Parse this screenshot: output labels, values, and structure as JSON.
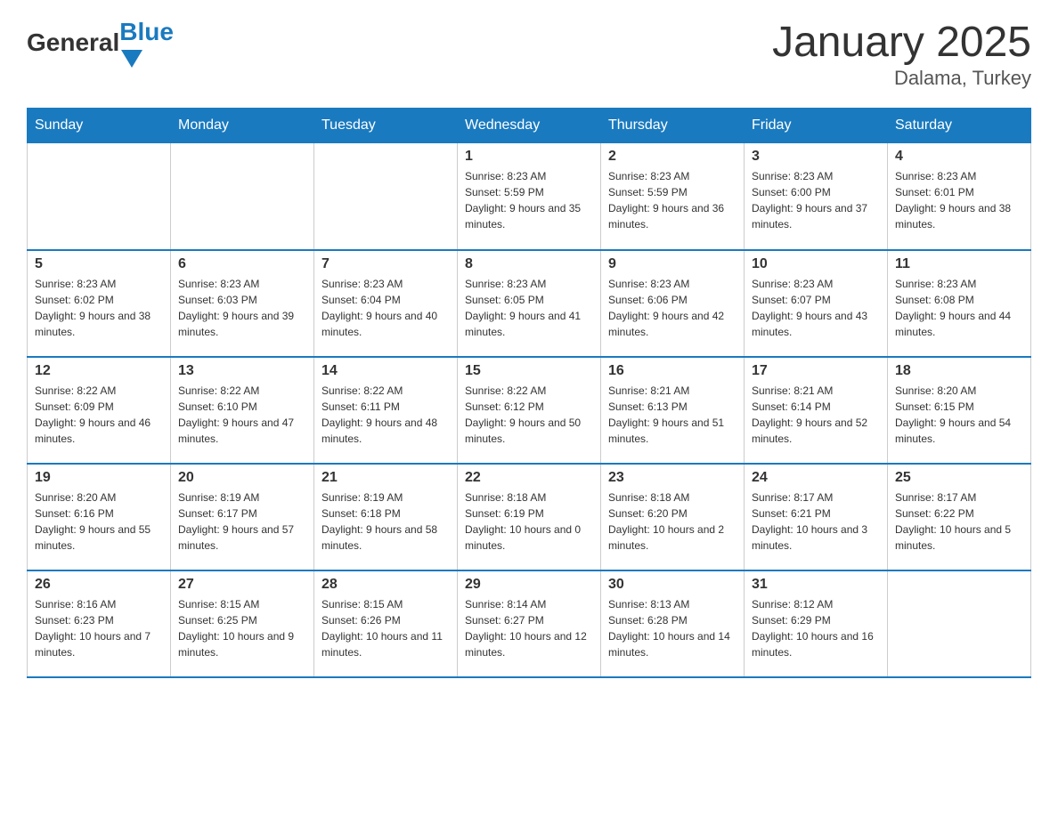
{
  "logo": {
    "general": "General",
    "blue": "Blue",
    "triangle": "▲"
  },
  "header": {
    "month_year": "January 2025",
    "location": "Dalama, Turkey"
  },
  "weekdays": [
    "Sunday",
    "Monday",
    "Tuesday",
    "Wednesday",
    "Thursday",
    "Friday",
    "Saturday"
  ],
  "weeks": [
    [
      {
        "day": "",
        "sunrise": "",
        "sunset": "",
        "daylight": ""
      },
      {
        "day": "",
        "sunrise": "",
        "sunset": "",
        "daylight": ""
      },
      {
        "day": "",
        "sunrise": "",
        "sunset": "",
        "daylight": ""
      },
      {
        "day": "1",
        "sunrise": "Sunrise: 8:23 AM",
        "sunset": "Sunset: 5:59 PM",
        "daylight": "Daylight: 9 hours and 35 minutes."
      },
      {
        "day": "2",
        "sunrise": "Sunrise: 8:23 AM",
        "sunset": "Sunset: 5:59 PM",
        "daylight": "Daylight: 9 hours and 36 minutes."
      },
      {
        "day": "3",
        "sunrise": "Sunrise: 8:23 AM",
        "sunset": "Sunset: 6:00 PM",
        "daylight": "Daylight: 9 hours and 37 minutes."
      },
      {
        "day": "4",
        "sunrise": "Sunrise: 8:23 AM",
        "sunset": "Sunset: 6:01 PM",
        "daylight": "Daylight: 9 hours and 38 minutes."
      }
    ],
    [
      {
        "day": "5",
        "sunrise": "Sunrise: 8:23 AM",
        "sunset": "Sunset: 6:02 PM",
        "daylight": "Daylight: 9 hours and 38 minutes."
      },
      {
        "day": "6",
        "sunrise": "Sunrise: 8:23 AM",
        "sunset": "Sunset: 6:03 PM",
        "daylight": "Daylight: 9 hours and 39 minutes."
      },
      {
        "day": "7",
        "sunrise": "Sunrise: 8:23 AM",
        "sunset": "Sunset: 6:04 PM",
        "daylight": "Daylight: 9 hours and 40 minutes."
      },
      {
        "day": "8",
        "sunrise": "Sunrise: 8:23 AM",
        "sunset": "Sunset: 6:05 PM",
        "daylight": "Daylight: 9 hours and 41 minutes."
      },
      {
        "day": "9",
        "sunrise": "Sunrise: 8:23 AM",
        "sunset": "Sunset: 6:06 PM",
        "daylight": "Daylight: 9 hours and 42 minutes."
      },
      {
        "day": "10",
        "sunrise": "Sunrise: 8:23 AM",
        "sunset": "Sunset: 6:07 PM",
        "daylight": "Daylight: 9 hours and 43 minutes."
      },
      {
        "day": "11",
        "sunrise": "Sunrise: 8:23 AM",
        "sunset": "Sunset: 6:08 PM",
        "daylight": "Daylight: 9 hours and 44 minutes."
      }
    ],
    [
      {
        "day": "12",
        "sunrise": "Sunrise: 8:22 AM",
        "sunset": "Sunset: 6:09 PM",
        "daylight": "Daylight: 9 hours and 46 minutes."
      },
      {
        "day": "13",
        "sunrise": "Sunrise: 8:22 AM",
        "sunset": "Sunset: 6:10 PM",
        "daylight": "Daylight: 9 hours and 47 minutes."
      },
      {
        "day": "14",
        "sunrise": "Sunrise: 8:22 AM",
        "sunset": "Sunset: 6:11 PM",
        "daylight": "Daylight: 9 hours and 48 minutes."
      },
      {
        "day": "15",
        "sunrise": "Sunrise: 8:22 AM",
        "sunset": "Sunset: 6:12 PM",
        "daylight": "Daylight: 9 hours and 50 minutes."
      },
      {
        "day": "16",
        "sunrise": "Sunrise: 8:21 AM",
        "sunset": "Sunset: 6:13 PM",
        "daylight": "Daylight: 9 hours and 51 minutes."
      },
      {
        "day": "17",
        "sunrise": "Sunrise: 8:21 AM",
        "sunset": "Sunset: 6:14 PM",
        "daylight": "Daylight: 9 hours and 52 minutes."
      },
      {
        "day": "18",
        "sunrise": "Sunrise: 8:20 AM",
        "sunset": "Sunset: 6:15 PM",
        "daylight": "Daylight: 9 hours and 54 minutes."
      }
    ],
    [
      {
        "day": "19",
        "sunrise": "Sunrise: 8:20 AM",
        "sunset": "Sunset: 6:16 PM",
        "daylight": "Daylight: 9 hours and 55 minutes."
      },
      {
        "day": "20",
        "sunrise": "Sunrise: 8:19 AM",
        "sunset": "Sunset: 6:17 PM",
        "daylight": "Daylight: 9 hours and 57 minutes."
      },
      {
        "day": "21",
        "sunrise": "Sunrise: 8:19 AM",
        "sunset": "Sunset: 6:18 PM",
        "daylight": "Daylight: 9 hours and 58 minutes."
      },
      {
        "day": "22",
        "sunrise": "Sunrise: 8:18 AM",
        "sunset": "Sunset: 6:19 PM",
        "daylight": "Daylight: 10 hours and 0 minutes."
      },
      {
        "day": "23",
        "sunrise": "Sunrise: 8:18 AM",
        "sunset": "Sunset: 6:20 PM",
        "daylight": "Daylight: 10 hours and 2 minutes."
      },
      {
        "day": "24",
        "sunrise": "Sunrise: 8:17 AM",
        "sunset": "Sunset: 6:21 PM",
        "daylight": "Daylight: 10 hours and 3 minutes."
      },
      {
        "day": "25",
        "sunrise": "Sunrise: 8:17 AM",
        "sunset": "Sunset: 6:22 PM",
        "daylight": "Daylight: 10 hours and 5 minutes."
      }
    ],
    [
      {
        "day": "26",
        "sunrise": "Sunrise: 8:16 AM",
        "sunset": "Sunset: 6:23 PM",
        "daylight": "Daylight: 10 hours and 7 minutes."
      },
      {
        "day": "27",
        "sunrise": "Sunrise: 8:15 AM",
        "sunset": "Sunset: 6:25 PM",
        "daylight": "Daylight: 10 hours and 9 minutes."
      },
      {
        "day": "28",
        "sunrise": "Sunrise: 8:15 AM",
        "sunset": "Sunset: 6:26 PM",
        "daylight": "Daylight: 10 hours and 11 minutes."
      },
      {
        "day": "29",
        "sunrise": "Sunrise: 8:14 AM",
        "sunset": "Sunset: 6:27 PM",
        "daylight": "Daylight: 10 hours and 12 minutes."
      },
      {
        "day": "30",
        "sunrise": "Sunrise: 8:13 AM",
        "sunset": "Sunset: 6:28 PM",
        "daylight": "Daylight: 10 hours and 14 minutes."
      },
      {
        "day": "31",
        "sunrise": "Sunrise: 8:12 AM",
        "sunset": "Sunset: 6:29 PM",
        "daylight": "Daylight: 10 hours and 16 minutes."
      },
      {
        "day": "",
        "sunrise": "",
        "sunset": "",
        "daylight": ""
      }
    ]
  ]
}
